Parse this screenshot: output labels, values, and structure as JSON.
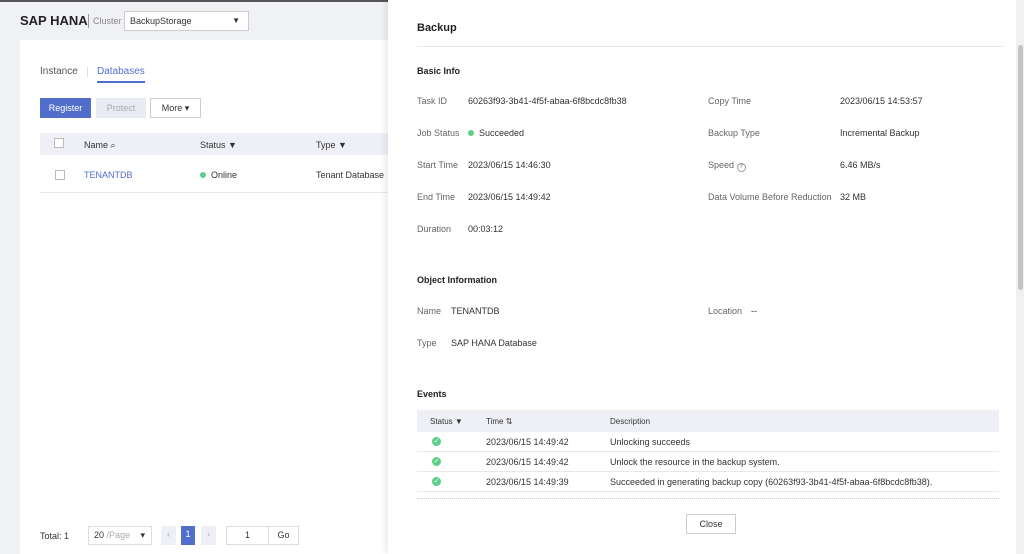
{
  "header": {
    "product": "SAP HANA",
    "cluster_label": "Cluster",
    "cluster_value": "BackupStorage"
  },
  "tabs": [
    {
      "label": "Instance"
    },
    {
      "label": "Databases"
    }
  ],
  "toolbar": {
    "register": "Register",
    "protect": "Protect",
    "more": "More"
  },
  "table": {
    "columns": [
      "Name",
      "Status",
      "Type"
    ],
    "rows": [
      {
        "name": "TENANTDB",
        "status": "Online",
        "type": "Tenant Database"
      }
    ]
  },
  "pagination": {
    "total": "Total: 1",
    "page_size": "20",
    "page_size_unit": "/Page",
    "current": "1",
    "goto_value": "1",
    "go": "Go"
  },
  "panel": {
    "title": "Backup",
    "basic_info": "Basic Info",
    "task_id_l": "Task ID",
    "task_id": "60263f93-3b41-4f5f-abaa-6f8bcdc8fb38",
    "job_status_l": "Job Status",
    "job_status": "Succeeded",
    "start_l": "Start Time",
    "start": "2023/06/15 14:46:30",
    "end_l": "End Time",
    "end": "2023/06/15 14:49:42",
    "duration_l": "Duration",
    "duration": "00:03:12",
    "copy_time_l": "Copy Time",
    "copy_time": "2023/06/15 14:53:57",
    "backup_type_l": "Backup Type",
    "backup_type": "Incremental Backup",
    "speed_l": "Speed",
    "speed": "6.46 MB/s",
    "volume_l": "Data Volume Before Reduction",
    "volume": "32 MB",
    "object_info": "Object Information",
    "name_l": "Name",
    "name": "TENANTDB",
    "location_l": "Location",
    "location": "--",
    "type_l": "Type",
    "type": "SAP HANA Database",
    "events": "Events",
    "event_cols": [
      "Status",
      "Time",
      "Description"
    ],
    "event_rows": [
      {
        "time": "2023/06/15 14:49:42",
        "desc": "Unlocking succeeds"
      },
      {
        "time": "2023/06/15 14:49:42",
        "desc": "Unlock the resource in the backup system."
      },
      {
        "time": "2023/06/15 14:49:39",
        "desc": "Succeeded in generating backup copy (60263f93-3b41-4f5f-abaa-6f8bcdc8fb38)."
      }
    ],
    "close": "Close"
  },
  "colors": {
    "accent": "#526ecc",
    "success": "#5ccf86"
  }
}
